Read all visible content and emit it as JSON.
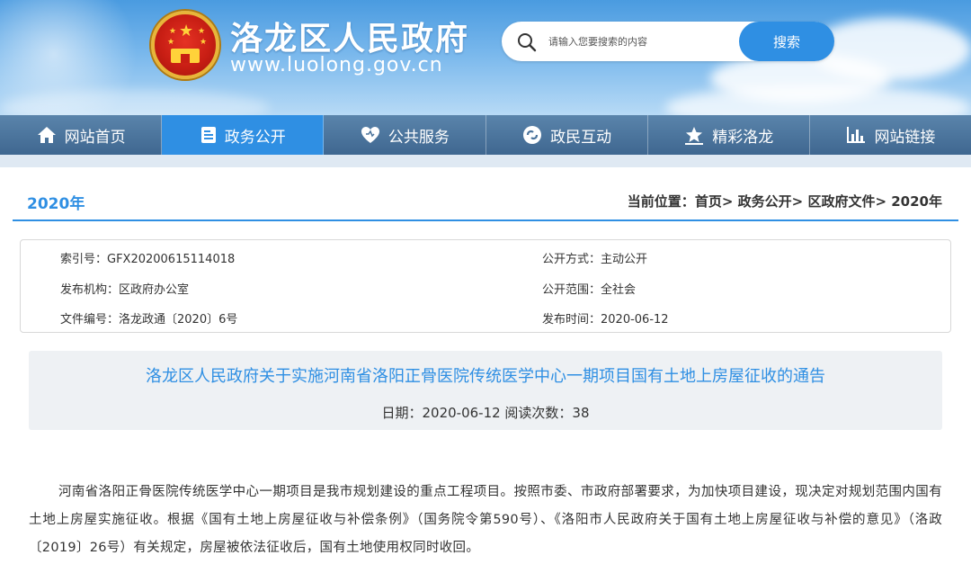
{
  "header": {
    "site_title": "洛龙区人民政府",
    "site_url": "www.luolong.gov.cn"
  },
  "search": {
    "placeholder": "请输入您要搜索的内容",
    "button_label": "搜索"
  },
  "nav": {
    "items": [
      {
        "label": "网站首页",
        "icon": "home-icon"
      },
      {
        "label": "政务公开",
        "icon": "document-icon",
        "active": true
      },
      {
        "label": "公共服务",
        "icon": "heart-icon"
      },
      {
        "label": "政民互动",
        "icon": "interact-icon"
      },
      {
        "label": "精彩洛龙",
        "icon": "star-icon"
      },
      {
        "label": "网站链接",
        "icon": "chart-icon"
      }
    ]
  },
  "panel": {
    "year_label": "2020年",
    "breadcrumb": {
      "prefix": "当前位置：",
      "items": [
        "首页",
        "政务公开",
        "区政府文件",
        "2020年"
      ]
    }
  },
  "meta": {
    "index_no": "索引号：GFX20200615114018",
    "publisher": "发布机构：区政府办公室",
    "doc_no": "文件编号：洛龙政通〔2020〕6号",
    "open_mode": "公开方式：主动公开",
    "open_scope": "公开范围：全社会",
    "publish_date": "发布时间：2020-06-12"
  },
  "document": {
    "title": "洛龙区人民政府关于实施河南省洛阳正骨医院传统医学中心一期项目国有土地上房屋征收的通告",
    "info": "日期：2020-06-12   阅读次数：38",
    "body": "河南省洛阳正骨医院传统医学中心一期项目是我市规划建设的重点工程项目。按照市委、市政府部署要求，为加快项目建设，现决定对规划范围内国有土地上房屋实施征收。根据《国有土地上房屋征收与补偿条例》（国务院令第590号）、《洛阳市人民政府关于国有土地上房屋征收与补偿的意见》（洛政〔2019〕26号）有关规定，房屋被依法征收后，国有土地使用权同时收回。"
  },
  "colors": {
    "accent": "#2f8fe3",
    "nav_bg": "#4a739b",
    "title_box_bg": "#eef1f4"
  }
}
